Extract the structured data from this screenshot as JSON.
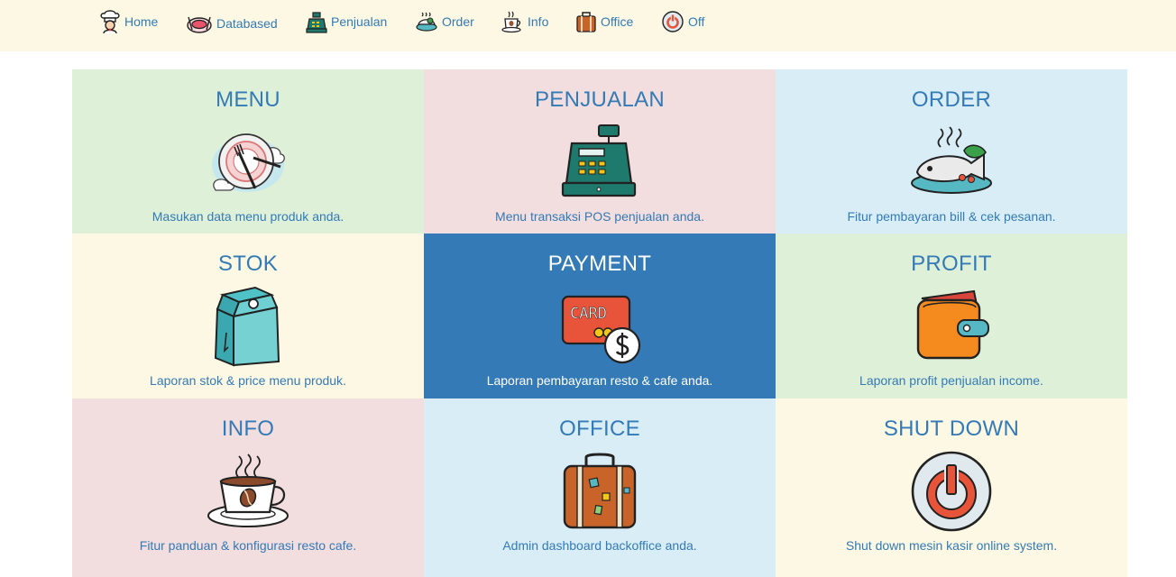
{
  "nav": {
    "items": [
      {
        "label": "Home",
        "icon": "chef-icon"
      },
      {
        "label": "Databased",
        "icon": "plate-icon"
      },
      {
        "label": "Penjualan",
        "icon": "cash-register-icon"
      },
      {
        "label": "Order",
        "icon": "food-dish-icon"
      },
      {
        "label": "Info",
        "icon": "coffee-cup-icon"
      },
      {
        "label": "Office",
        "icon": "suitcase-icon"
      },
      {
        "label": "Off",
        "icon": "power-icon"
      }
    ]
  },
  "tiles": [
    {
      "title": "MENU",
      "desc": "Masukan data menu produk anda.",
      "icon": "plate-fork-icon",
      "color": "#dff0d8"
    },
    {
      "title": "PENJUALAN",
      "desc": "Menu transaksi POS penjualan anda.",
      "icon": "cash-register-icon",
      "color": "#f2dede"
    },
    {
      "title": "ORDER",
      "desc": "Fitur pembayaran bill & cek pesanan.",
      "icon": "food-dish-icon",
      "color": "#d9edf7"
    },
    {
      "title": "STOK",
      "desc": "Laporan stok & price menu produk.",
      "icon": "milk-carton-icon",
      "color": "#fcf8e3"
    },
    {
      "title": "PAYMENT",
      "desc": "Laporan pembayaran resto & cafe anda.",
      "icon": "card-payment-icon",
      "color": "#337ab7",
      "card_text": "CARD"
    },
    {
      "title": "PROFIT",
      "desc": "Laporan profit penjualan income.",
      "icon": "wallet-icon",
      "color": "#dff0d8"
    },
    {
      "title": "INFO",
      "desc": "Fitur panduan & konfigurasi resto cafe.",
      "icon": "coffee-cup-icon",
      "color": "#f2dede"
    },
    {
      "title": "OFFICE",
      "desc": "Admin dashboard backoffice anda.",
      "icon": "suitcase-icon",
      "color": "#d9edf7"
    },
    {
      "title": "SHUT DOWN",
      "desc": "Shut down mesin kasir online system.",
      "icon": "power-icon",
      "color": "#fcf8e3"
    }
  ],
  "colors": {
    "link": "#337ab7",
    "nav_bg": "#fcf8e3",
    "active_tile": "#337ab7"
  }
}
